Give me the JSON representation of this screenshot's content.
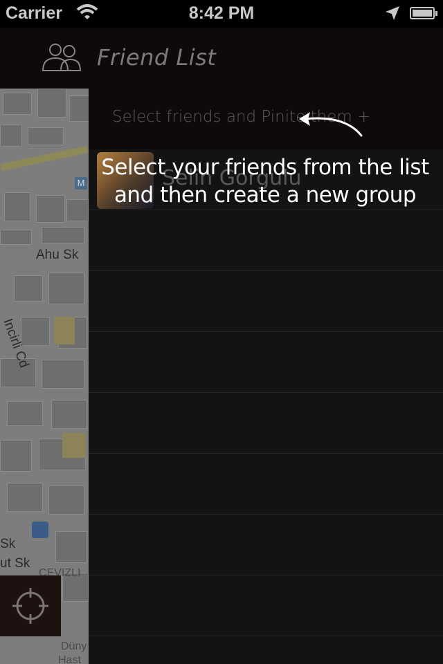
{
  "status_bar": {
    "carrier": "Carrier",
    "time": "8:42 PM"
  },
  "header": {
    "title": "Friend List",
    "icon": "friends-group-icon"
  },
  "panel": {
    "hint": "Select friends and Pinite them +",
    "friends": [
      {
        "name": "Selin Gorgulu"
      }
    ]
  },
  "map": {
    "labels": [
      "Ahu Sk",
      "Incirli Cd",
      "Sk",
      "ut Sk",
      "CEVIZLI",
      "Düny",
      "Hast"
    ],
    "metro_badge": "M"
  },
  "tutorial": {
    "line1": "Select your friends from the list",
    "line2": "and then create a new group"
  },
  "colors": {
    "header_bg": "#0e0a0a",
    "panel_bg": "#131313",
    "locate_bg": "#1e1210"
  }
}
